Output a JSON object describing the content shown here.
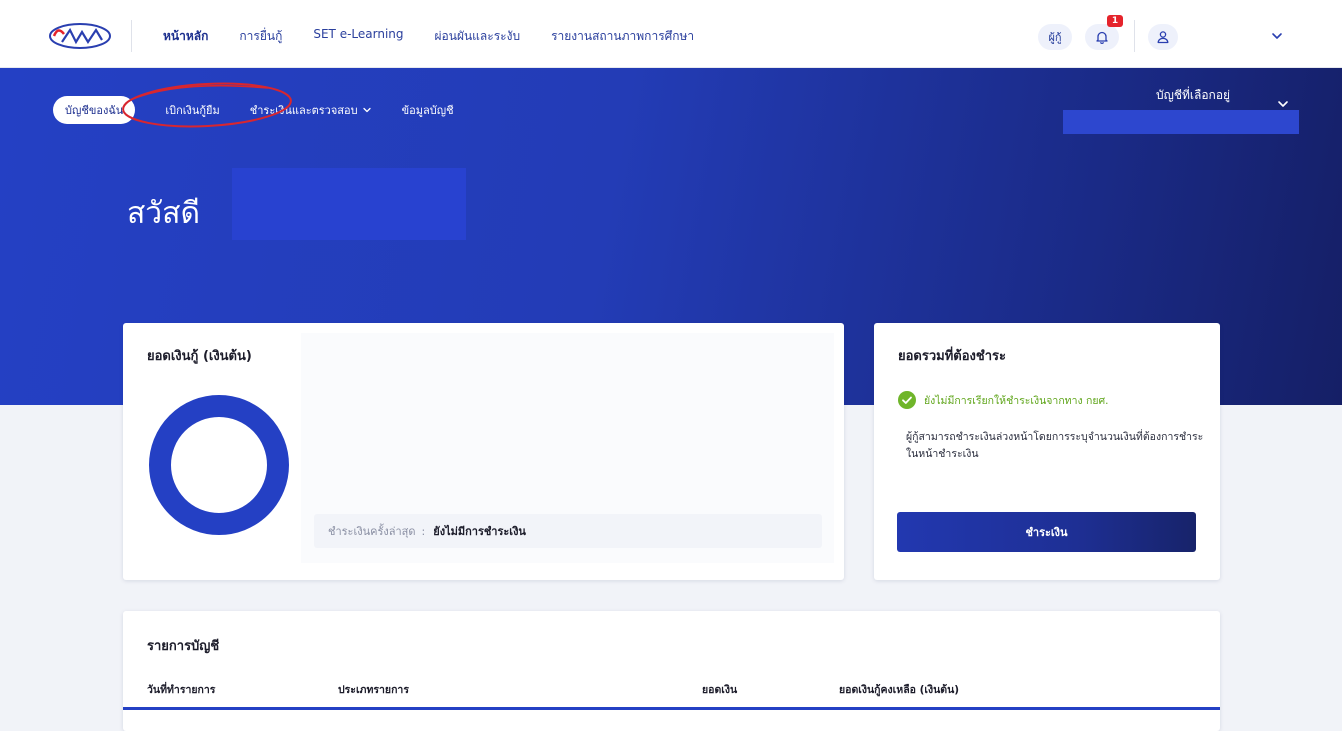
{
  "header": {
    "logo_text": "กยศ",
    "nav": [
      {
        "label": "หน้าหลัก",
        "active": true
      },
      {
        "label": "การยื่นกู้",
        "active": false
      },
      {
        "label": "SET e-Learning",
        "active": false
      },
      {
        "label": "ผ่อนผันและระงับ",
        "active": false
      },
      {
        "label": "รายงานสถานภาพการศึกษา",
        "active": false
      }
    ],
    "role_label": "ผู้กู้",
    "notification_count": "1",
    "user_icon": "user-icon",
    "bell_icon": "bell-icon"
  },
  "subnav": {
    "items": [
      {
        "label": "บัญชีของฉัน",
        "active": true
      },
      {
        "label": "เบิกเงินกู้ยืม",
        "active": false
      },
      {
        "label": "ชำระเงินและตรวจสอบ",
        "active": false,
        "has_dropdown": true
      },
      {
        "label": "ข้อมูลบัญชี",
        "active": false
      }
    ],
    "account_select_label": "บัญชีที่เลือกอยู่"
  },
  "hero": {
    "greeting": "สวัสดี"
  },
  "loan_card": {
    "title": "ยอดเงินกู้ (เงินต้น)",
    "last_payment_label": "ชำระเงินครั้งล่าสุด",
    "last_payment_separator": ":",
    "last_payment_value": "ยังไม่มีการชำระเงิน"
  },
  "due_card": {
    "title": "ยอดรวมที่ต้องชำระ",
    "status_text": "ยังไม่มีการเรียกให้ชำระเงินจากทาง กยศ.",
    "note": "ผู้กู้สามารถชำระเงินล่วงหน้าโดยการระบุจำนวนเงินที่ต้องการชำระในหน้าชำระเงิน",
    "pay_button_label": "ชำระเงิน"
  },
  "ledger": {
    "title": "รายการบัญชี",
    "columns": [
      "วันที่ทำรายการ",
      "ประเภทรายการ",
      "ยอดเงิน",
      "ยอดเงินกู้คงเหลือ (เงินต้น)"
    ]
  },
  "colors": {
    "brand_blue": "#2440c4",
    "brand_dark": "#151f66",
    "success_green": "#5fa51a",
    "alert_red": "#e5232b",
    "annotation_red": "#d8262f"
  }
}
